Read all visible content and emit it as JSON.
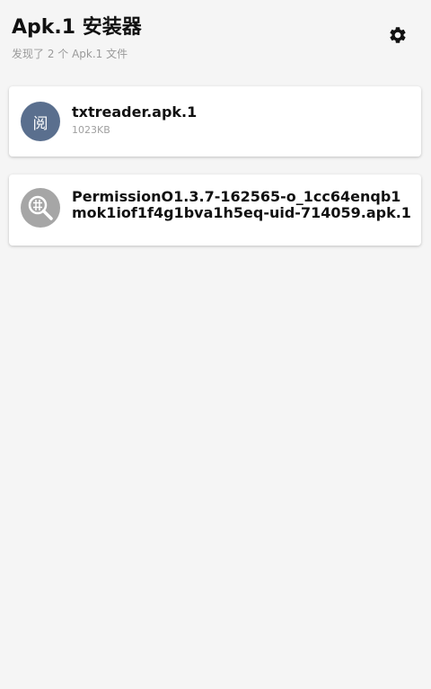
{
  "header": {
    "title": "Apk.1 安装器",
    "subtitle": "发现了 2 个 Apk.1 文件",
    "settings_icon": "gear-icon"
  },
  "files": [
    {
      "name": "txtreader.apk.1",
      "size": "1023KB",
      "icon_text": "阅",
      "icon_color": "#5a6f8e"
    },
    {
      "name": "PermissionO1.3.7-162565-o_1cc64enqb1mok1iof1f4g1bva1h5eq-uid-714059.apk.1",
      "icon": "search-globe-icon",
      "icon_color": "#a6a6a6"
    }
  ]
}
